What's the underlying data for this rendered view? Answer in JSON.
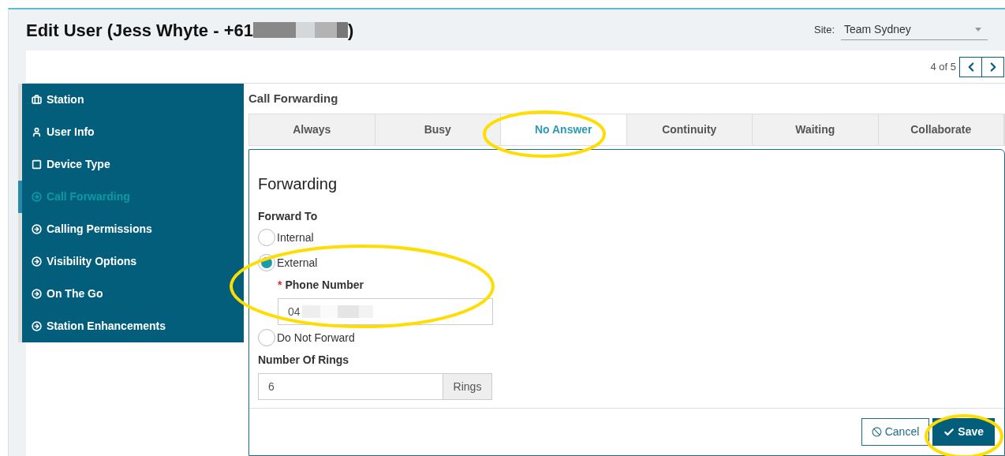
{
  "header": {
    "title": "Edit User (Jess Whyte - +61",
    "title_end": ")",
    "site_label": "Site:",
    "site_value": "Team Sydney"
  },
  "pager": {
    "text": "4 of 5"
  },
  "sidebar": {
    "items": [
      {
        "label": "Station",
        "selected": false
      },
      {
        "label": "User Info",
        "selected": false
      },
      {
        "label": "Device Type",
        "selected": false
      },
      {
        "label": "Call Forwarding",
        "selected": true
      },
      {
        "label": "Calling Permissions",
        "selected": false
      },
      {
        "label": "Visibility Options",
        "selected": false
      },
      {
        "label": "On The Go",
        "selected": false
      },
      {
        "label": "Station Enhancements",
        "selected": false
      }
    ]
  },
  "section_title": "Call Forwarding",
  "tabs": [
    {
      "label": "Always",
      "selected": false
    },
    {
      "label": "Busy",
      "selected": false
    },
    {
      "label": "No Answer",
      "selected": true
    },
    {
      "label": "Continuity",
      "selected": false
    },
    {
      "label": "Waiting",
      "selected": false
    },
    {
      "label": "Collaborate",
      "selected": false
    }
  ],
  "form": {
    "heading": "Forwarding",
    "forward_label": "Forward To",
    "options": [
      {
        "label": "Internal",
        "selected": false
      },
      {
        "label": "External",
        "selected": true
      },
      {
        "label": "Do Not Forward",
        "selected": false
      }
    ],
    "phone_required": "*",
    "phone_label": "Phone Number",
    "phone_value": "04",
    "rings_label": "Number Of Rings",
    "rings_value": "6",
    "rings_addon": "Rings"
  },
  "buttons": {
    "cancel": "Cancel",
    "save": "Save"
  }
}
